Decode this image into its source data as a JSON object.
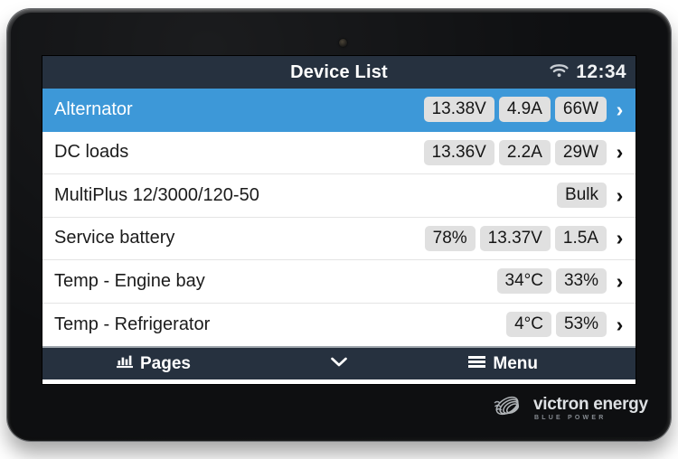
{
  "device": {
    "brand_name": "victron energy",
    "brand_tagline": "BLUE POWER",
    "logo_icon": "victron-logo-mark",
    "sensor_icon": "ambient-light-sensor"
  },
  "statusbar": {
    "title": "Device List",
    "wifi_icon": "wifi-icon",
    "clock": "12:34"
  },
  "rows": [
    {
      "label": "Alternator",
      "selected": true,
      "badges": [
        "13.38V",
        "4.9A",
        "66W"
      ],
      "chevron": "›"
    },
    {
      "label": "DC loads",
      "selected": false,
      "badges": [
        "13.36V",
        "2.2A",
        "29W"
      ],
      "chevron": "›"
    },
    {
      "label": "MultiPlus 12/3000/120-50",
      "selected": false,
      "badges": [
        "Bulk"
      ],
      "chevron": "›"
    },
    {
      "label": "Service battery",
      "selected": false,
      "badges": [
        "78%",
        "13.37V",
        "1.5A"
      ],
      "chevron": "›"
    },
    {
      "label": "Temp - Engine bay",
      "selected": false,
      "badges": [
        "34°C",
        "33%"
      ],
      "chevron": "›"
    },
    {
      "label": "Temp - Refrigerator",
      "selected": false,
      "badges": [
        "4°C",
        "53%"
      ],
      "chevron": "›"
    }
  ],
  "footer": {
    "pages_label": "Pages",
    "pages_icon": "bar-chart-icon",
    "scroll_icon": "chevron-down-icon",
    "menu_label": "Menu",
    "menu_icon": "hamburger-icon"
  },
  "colors": {
    "statusbar_bg": "#26313f",
    "selected_row_bg": "#3d98d8",
    "badge_bg": "#e0e0e0",
    "row_bg": "#ffffff",
    "divider": "#e4e4e4",
    "text": "#1b1b1b",
    "footer_border": "#9fa6ad"
  }
}
